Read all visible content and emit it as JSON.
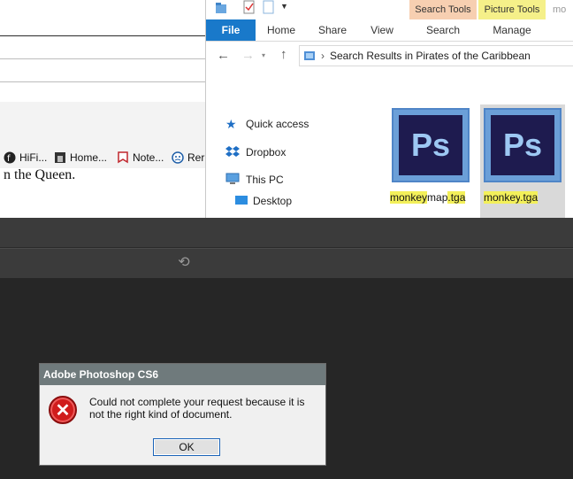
{
  "browser": {
    "bookmarks": [
      {
        "label": "HiFi...",
        "icon": "hifi-icon"
      },
      {
        "label": "Home...",
        "icon": "home-icon"
      },
      {
        "label": "Note...",
        "icon": "note-icon"
      },
      {
        "label": "Rer",
        "icon": "smiley-icon"
      }
    ],
    "page_text": "n the Queen."
  },
  "explorer": {
    "qat_icons": [
      "folder-icon",
      "properties-icon",
      "new-folder-icon",
      "dropdown-icon"
    ],
    "contextual_headers": {
      "search": "Search Tools",
      "picture": "Picture Tools",
      "extra": "mo"
    },
    "tabs": [
      "File",
      "Home",
      "Share",
      "View",
      "Search",
      "Manage"
    ],
    "address": "Search Results in Pirates of the Caribbean",
    "nav_items": [
      {
        "label": "Quick access",
        "icon": "star-icon"
      },
      {
        "label": "Dropbox",
        "icon": "dropbox-icon"
      },
      {
        "label": "This PC",
        "icon": "computer-icon"
      },
      {
        "label": "Desktop",
        "icon": "desktop-icon"
      }
    ],
    "files": [
      {
        "highlight": "monkey",
        "rest": "map",
        "highlight2": ".tga",
        "icon_text": "Ps"
      },
      {
        "highlight": "monkey",
        "rest": "",
        "highlight2": ".tga",
        "icon_text": "Ps"
      }
    ]
  },
  "dialog": {
    "title": "Adobe Photoshop CS6",
    "message": "Could not complete your request because it is not the right kind of document.",
    "ok_label": "OK",
    "icon": "error-icon"
  },
  "colors": {
    "ribbon_file": "#1979ca",
    "search_tools": "#f7cfb1",
    "picture_tools": "#f5f089",
    "dialog_title": "#6f7a7c",
    "highlight": "#f3f05a"
  }
}
